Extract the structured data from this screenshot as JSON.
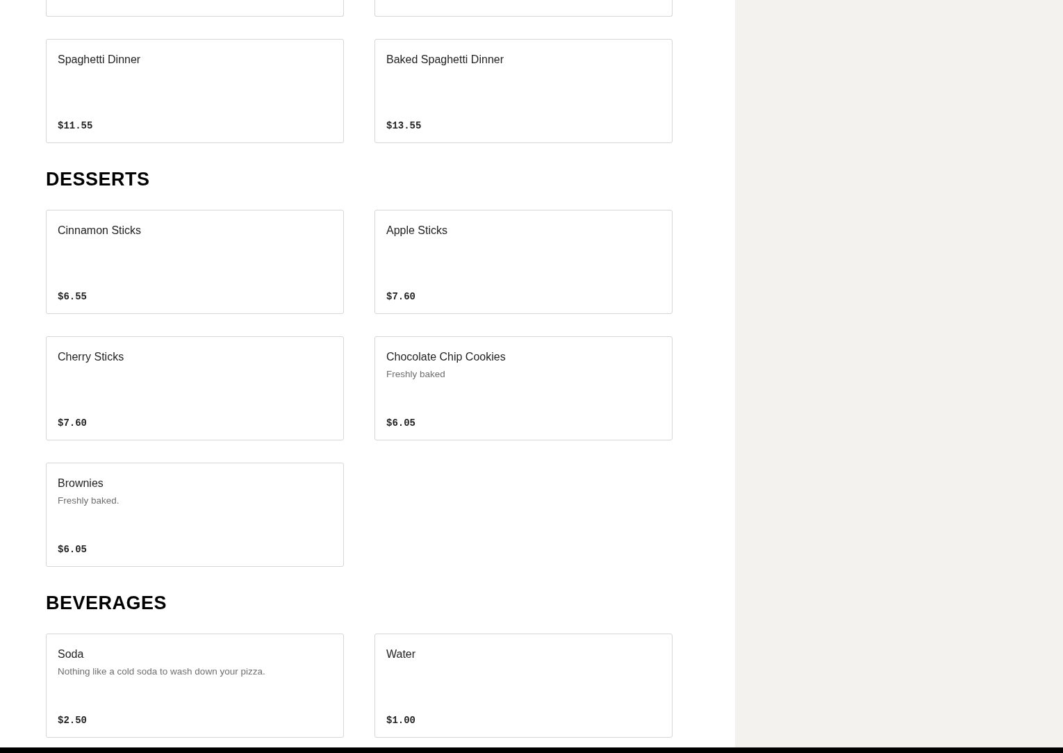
{
  "sections": [
    {
      "items": [
        {
          "name": "Spaghetti Dinner",
          "price": "$11.55"
        },
        {
          "name": "Baked Spaghetti Dinner",
          "price": "$13.55"
        }
      ]
    },
    {
      "heading": "DESSERTS",
      "items": [
        {
          "name": "Cinnamon Sticks",
          "price": "$6.55"
        },
        {
          "name": "Apple Sticks",
          "price": "$7.60"
        },
        {
          "name": "Cherry Sticks",
          "price": "$7.60"
        },
        {
          "name": "Chocolate Chip Cookies",
          "description": "Freshly baked",
          "price": "$6.05"
        },
        {
          "name": "Brownies",
          "description": "Freshly baked.",
          "price": "$6.05"
        }
      ]
    },
    {
      "heading": "BEVERAGES",
      "items": [
        {
          "name": "Soda",
          "description": "Nothing like a cold soda to wash down your pizza.",
          "price": "$2.50"
        },
        {
          "name": "Water",
          "price": "$1.00"
        }
      ]
    }
  ]
}
